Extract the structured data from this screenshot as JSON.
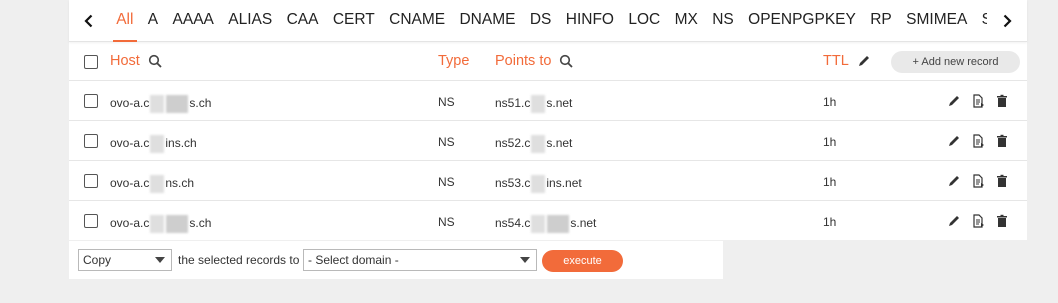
{
  "tabs": {
    "items": [
      "All",
      "A",
      "AAAA",
      "ALIAS",
      "CAA",
      "CERT",
      "CNAME",
      "DNAME",
      "DS",
      "HINFO",
      "LOC",
      "MX",
      "NS",
      "OPENPGPKEY",
      "RP",
      "SMIMEA",
      "SPF"
    ],
    "active": "All"
  },
  "table": {
    "headers": {
      "host": "Host",
      "type": "Type",
      "points_to": "Points to",
      "ttl": "TTL",
      "add_button": "+ Add new record"
    },
    "rows": [
      {
        "host_a": "ovo-a.c",
        "host_b": "s.ch",
        "type": "NS",
        "points_a": "ns51.c",
        "points_b": "s.net",
        "ttl": "1h"
      },
      {
        "host_a": "ovo-a.c",
        "host_b": "ins.ch",
        "type": "NS",
        "points_a": "ns52.c",
        "points_b": "s.net",
        "ttl": "1h"
      },
      {
        "host_a": "ovo-a.c",
        "host_b": "ns.ch",
        "type": "NS",
        "points_a": "ns53.c",
        "points_b": "ins.net",
        "ttl": "1h"
      },
      {
        "host_a": "ovo-a.c",
        "host_b": "s.ch",
        "type": "NS",
        "points_a": "ns54.c",
        "points_b": "s.net",
        "ttl": "1h"
      }
    ]
  },
  "footer": {
    "action_select": "Copy",
    "middle_text": "the selected records to",
    "domain_select": "- Select domain -",
    "execute": "execute"
  },
  "colors": {
    "accent": "#f26b3a",
    "background": "#efefef"
  }
}
